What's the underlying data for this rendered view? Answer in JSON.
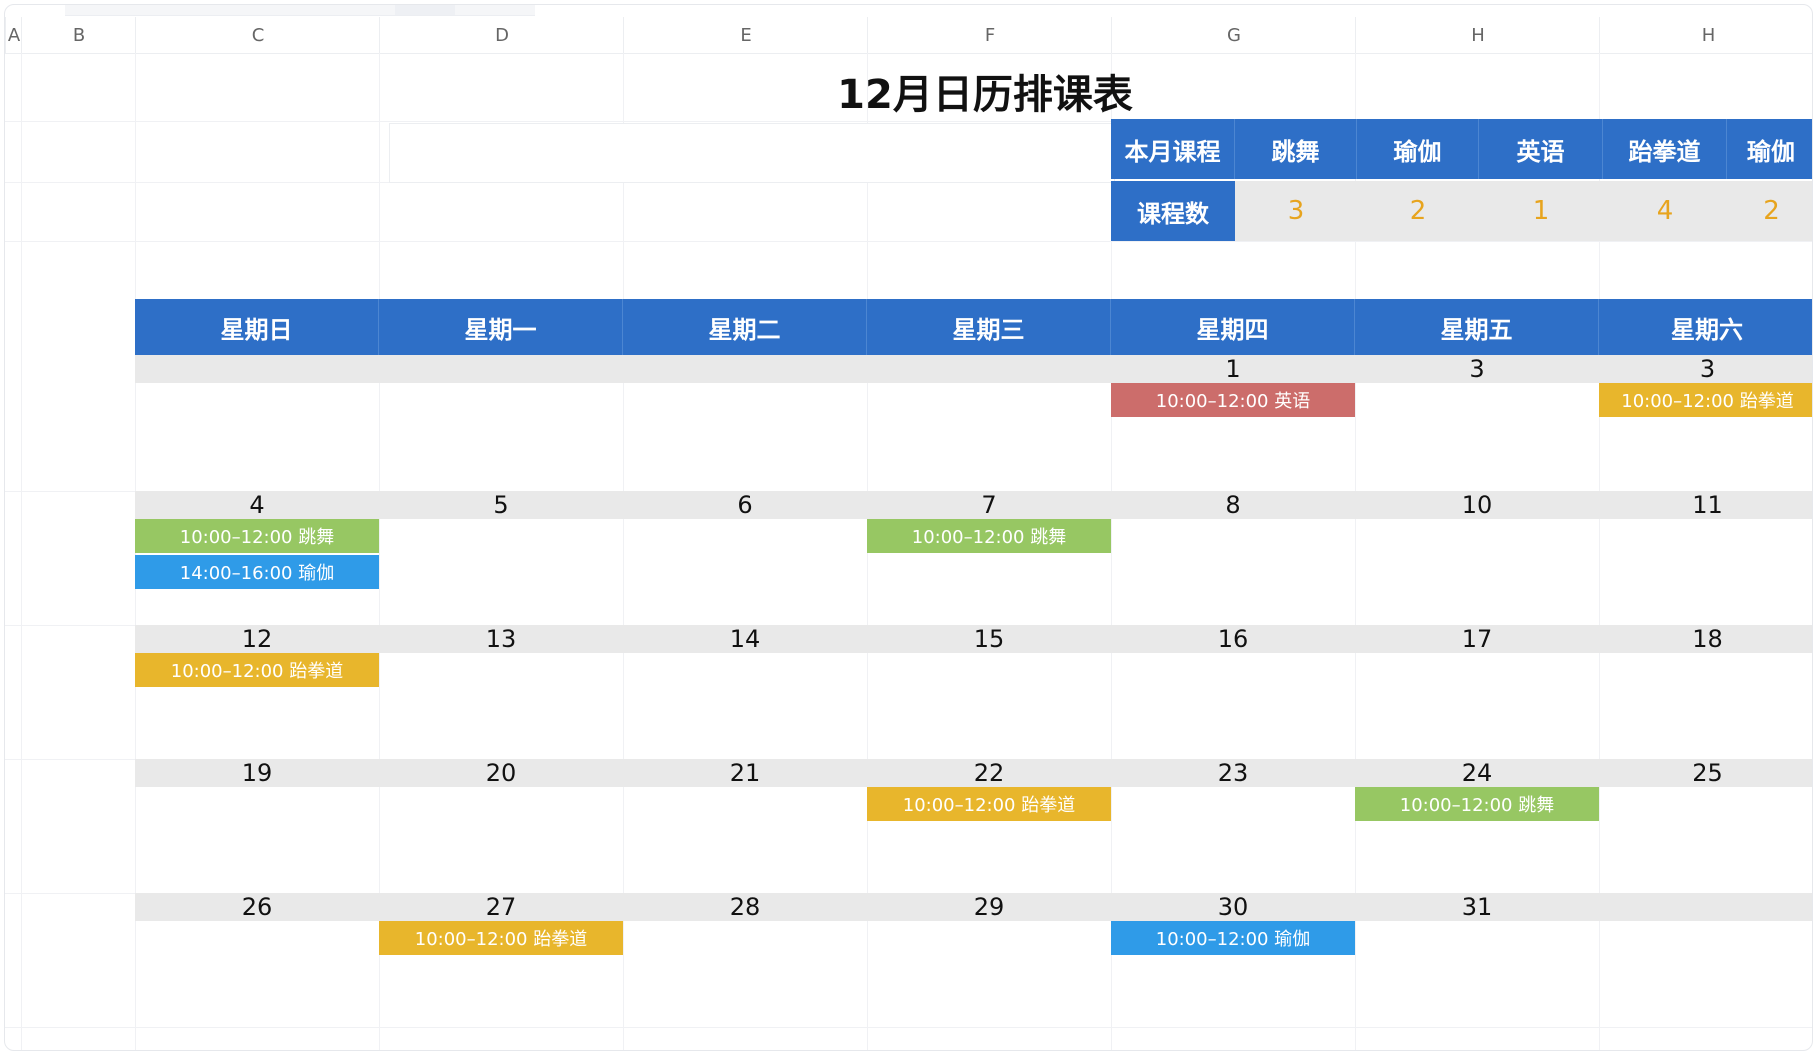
{
  "column_headers": [
    "A",
    "B",
    "C",
    "D",
    "E",
    "F",
    "G",
    "H",
    "H"
  ],
  "title": "12月日历排课表",
  "summary": {
    "header_label": "本月课程",
    "count_label": "课程数",
    "courses": [
      {
        "name": "跳舞",
        "count": "3"
      },
      {
        "name": "瑜伽",
        "count": "2"
      },
      {
        "name": "英语",
        "count": "1"
      },
      {
        "name": "跆拳道",
        "count": "4"
      },
      {
        "name": "瑜伽",
        "count": "2"
      }
    ]
  },
  "weekdays": [
    "星期日",
    "星期一",
    "星期二",
    "星期三",
    "星期四",
    "星期五",
    "星期六"
  ],
  "weeks": [
    [
      "",
      "",
      "",
      "",
      "1",
      "3",
      "3"
    ],
    [
      "4",
      "5",
      "6",
      "7",
      "8",
      "10",
      "11"
    ],
    [
      "12",
      "13",
      "14",
      "15",
      "16",
      "17",
      "18"
    ],
    [
      "19",
      "20",
      "21",
      "22",
      "23",
      "24",
      "25"
    ],
    [
      "26",
      "27",
      "28",
      "29",
      "30",
      "31",
      ""
    ]
  ],
  "colors": {
    "header_blue": "#2e6fc7",
    "dance_green": "#97c763",
    "yoga_blue": "#2f9be8",
    "english_red": "#cc6d6b",
    "taekwondo_yellow": "#e8b62c",
    "count_orange": "#e7a41e",
    "band_gray": "#e9e9e9"
  },
  "events": [
    {
      "week": 0,
      "day": 4,
      "slot": 0,
      "label": "10:00–12:00  英语",
      "color": "english_red"
    },
    {
      "week": 0,
      "day": 6,
      "slot": 0,
      "label": "10:00–12:00  跆拳道",
      "color": "taekwondo_yellow"
    },
    {
      "week": 1,
      "day": 0,
      "slot": 0,
      "label": "10:00–12:00  跳舞",
      "color": "dance_green"
    },
    {
      "week": 1,
      "day": 0,
      "slot": 1,
      "label": "14:00–16:00 瑜伽",
      "color": "yoga_blue"
    },
    {
      "week": 1,
      "day": 3,
      "slot": 0,
      "label": "10:00–12:00  跳舞",
      "color": "dance_green"
    },
    {
      "week": 2,
      "day": 0,
      "slot": 0,
      "label": "10:00–12:00  跆拳道",
      "color": "taekwondo_yellow"
    },
    {
      "week": 3,
      "day": 3,
      "slot": 0,
      "label": "10:00–12:00  跆拳道",
      "color": "taekwondo_yellow"
    },
    {
      "week": 3,
      "day": 5,
      "slot": 0,
      "label": "10:00–12:00  跳舞",
      "color": "dance_green"
    },
    {
      "week": 4,
      "day": 1,
      "slot": 0,
      "label": "10:00–12:00  跆拳道",
      "color": "taekwondo_yellow"
    },
    {
      "week": 4,
      "day": 4,
      "slot": 0,
      "label": "10:00–12:00  瑜伽",
      "color": "yoga_blue"
    }
  ]
}
